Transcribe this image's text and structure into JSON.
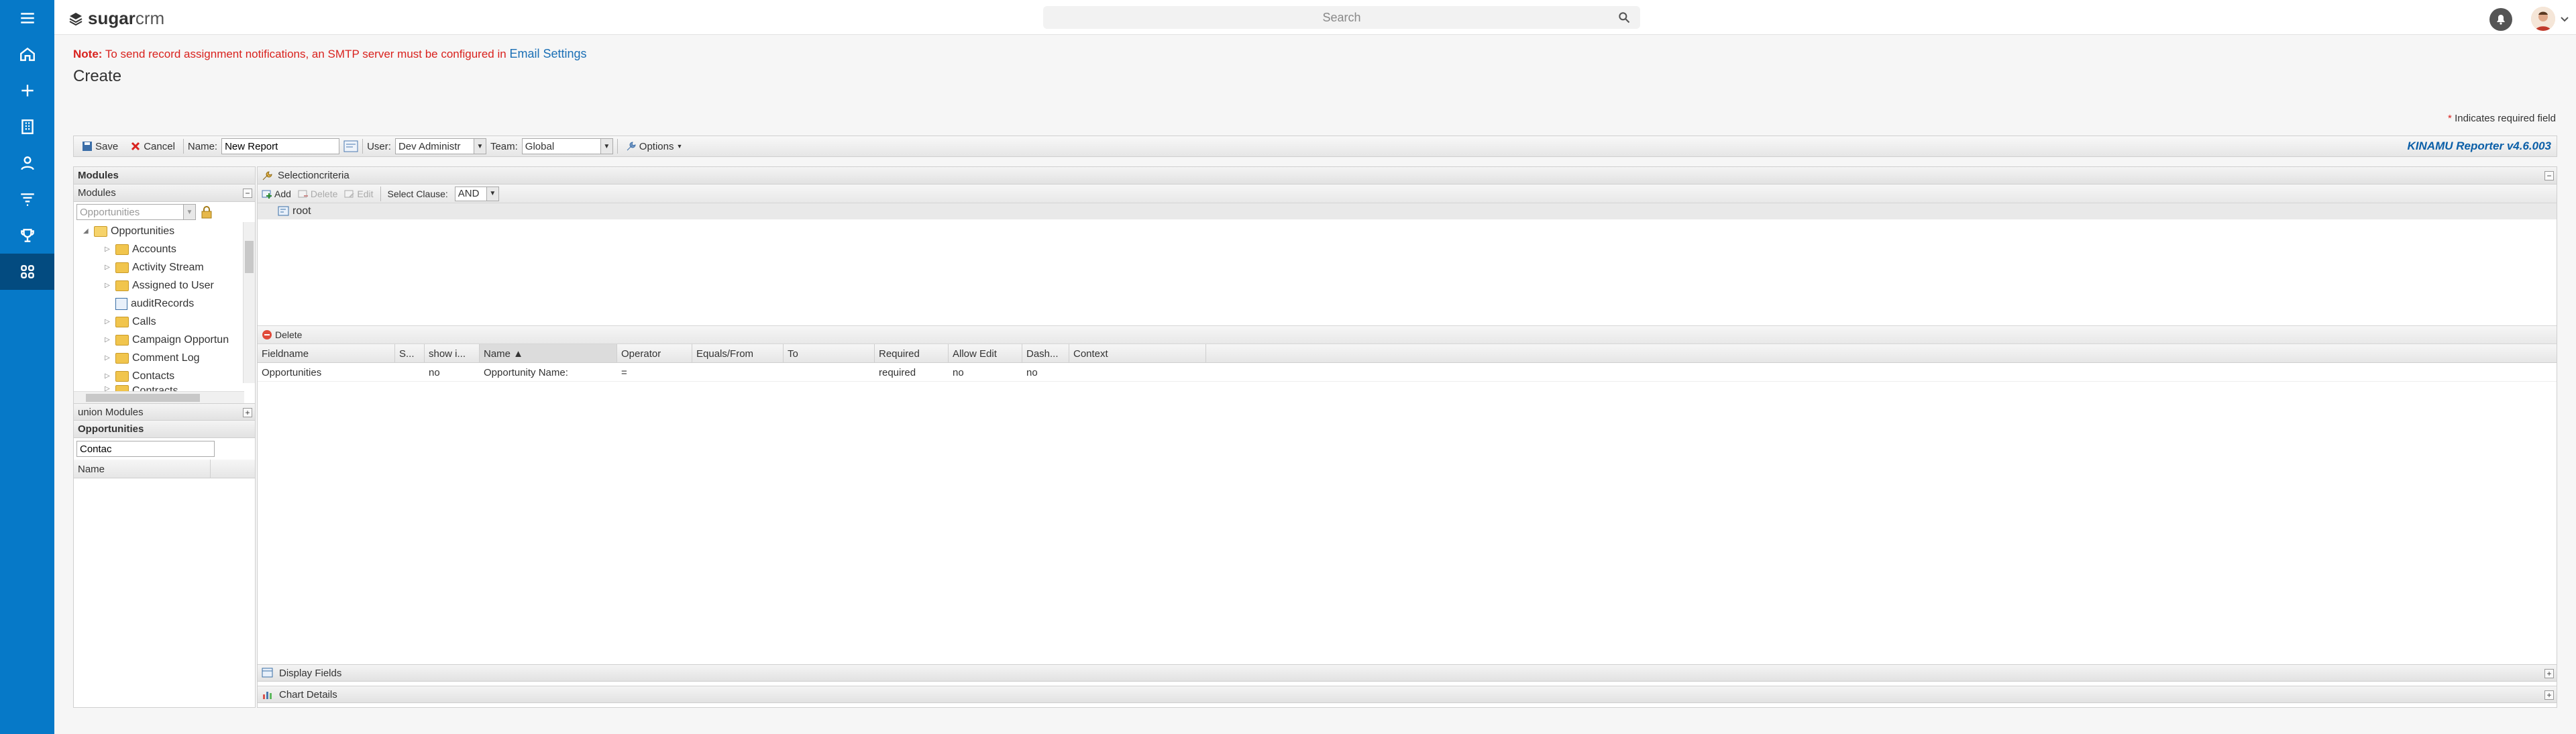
{
  "topbar": {
    "logo_brand": "sugar",
    "logo_suffix": "crm",
    "search_placeholder": "Search"
  },
  "nav": {
    "items": [
      "menu",
      "home",
      "create",
      "accounts",
      "contacts",
      "filter",
      "reports",
      "apps"
    ]
  },
  "page": {
    "note_label": "Note:",
    "note_text": "To send record assignment notifications, an SMTP server must be configured in",
    "note_link": "Email Settings",
    "title": "Create",
    "required_star": "*",
    "required_text": "Indicates required field"
  },
  "toolbar": {
    "save": "Save",
    "cancel": "Cancel",
    "name_label": "Name:",
    "name_value": "New Report",
    "user_label": "User:",
    "user_value": "Dev Administr",
    "team_label": "Team:",
    "team_value": "Global",
    "options": "Options",
    "version": "KINAMU Reporter v4.6.003"
  },
  "left": {
    "modules_title": "Modules",
    "modules_sub": "Modules",
    "module_select": "Opportunities",
    "tree": [
      {
        "label": "Opportunities",
        "type": "root"
      },
      {
        "label": "Accounts",
        "type": "folder"
      },
      {
        "label": "Activity Stream",
        "type": "folder"
      },
      {
        "label": "Assigned to User",
        "type": "folder"
      },
      {
        "label": "auditRecords",
        "type": "record"
      },
      {
        "label": "Calls",
        "type": "folder"
      },
      {
        "label": "Campaign Opportun",
        "type": "folder"
      },
      {
        "label": "Comment Log",
        "type": "folder"
      },
      {
        "label": "Contacts",
        "type": "folder"
      },
      {
        "label": "Contracts",
        "type": "folder"
      }
    ],
    "union_title": "union Modules",
    "opps_title": "Opportunities",
    "filter_value": "Contac",
    "name_col": "Name"
  },
  "right": {
    "selection_title": "Selectioncriteria",
    "add": "Add",
    "delete": "Delete",
    "edit": "Edit",
    "select_clause_label": "Select Clause:",
    "select_clause_value": "AND",
    "root_label": "root",
    "grid_delete": "Delete",
    "columns": [
      "Fieldname",
      "S...",
      "show i...",
      "Name ▲",
      "Operator",
      "Equals/From",
      "To",
      "Required",
      "Allow Edit",
      "Dash...",
      "Context"
    ],
    "rows": [
      [
        "Opportunities",
        "",
        "no",
        "Opportunity Name:",
        "=",
        "",
        "",
        "required",
        "no",
        "no",
        ""
      ]
    ],
    "display_fields": "Display Fields",
    "chart_details": "Chart Details"
  }
}
